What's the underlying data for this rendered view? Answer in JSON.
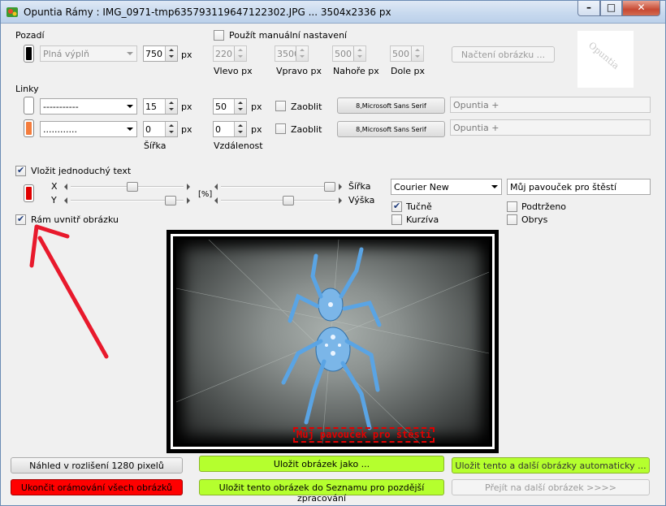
{
  "window": {
    "title": "Opuntia Rámy : IMG_0971-tmp635793119647122302.JPG ... 3504x2336 px",
    "controls": {
      "minimize": "–",
      "maximize": "□",
      "close": "✕"
    }
  },
  "background": {
    "section_label": "Pozadí",
    "swatch_color": "#000000",
    "fill_select": "Plná výplň",
    "width_value": "750",
    "unit": "px",
    "manual_checkbox_label": "Použít manuální nastavení",
    "manual_checked": false,
    "left_value": "220",
    "right_value": "3500",
    "top_value": "500",
    "bottom_value": "500",
    "left_label": "Vlevo px",
    "right_label": "Vpravo px",
    "top_label": "Nahoře px",
    "bottom_label": "Dole px",
    "load_image_button": "Načtení obrázku ...",
    "logo_text": "Opuntia"
  },
  "lines": {
    "section_label": "Linky",
    "rows": [
      {
        "swatch_color": "#ffffff",
        "style": "-----------",
        "width": "15",
        "distance": "50",
        "blur_label": "Zaoblit",
        "blur_checked": false,
        "font_button": "8,Microsoft Sans Serif",
        "text": "Opuntia +"
      },
      {
        "swatch_color": "#f47c3c",
        "style": "............",
        "width": "0",
        "distance": "0",
        "blur_label": "Zaoblit",
        "blur_checked": false,
        "font_button": "8,Microsoft Sans Serif",
        "text": "Opuntia +"
      }
    ],
    "unit": "px",
    "width_label": "Šířka",
    "distance_label": "Vzdálenost"
  },
  "simple_text": {
    "checkbox_label": "Vložit jednoduchý text",
    "checked": true,
    "swatch_color": "#e00000",
    "x_label": "X",
    "y_label": "Y",
    "percent_label": "[%]",
    "width_label": "Šířka",
    "height_label": "Výška",
    "x_value": 0.55,
    "y_value": 0.93,
    "width_value": 1.0,
    "height_value": 0.6,
    "font_select": "Courier New",
    "text_value": "Můj pavouček pro štěstí",
    "bold_label": "Tučně",
    "bold_checked": true,
    "italic_label": "Kurzíva",
    "italic_checked": false,
    "underline_label": "Podtrženo",
    "underline_checked": false,
    "outline_label": "Obrys",
    "outline_checked": false
  },
  "frame_inside": {
    "checkbox_label": "Rám uvnitř obrázku",
    "checked": true
  },
  "preview": {
    "overlay_text": "Můj pavouček pro štěstí",
    "overlay_color": "#e00000"
  },
  "buttons": {
    "preview_1280": "Náhled v rozlišení 1280 pixelů",
    "save_as": "Uložit obrázek jako ...",
    "save_auto": "Uložit tento a další obrázky automaticky ...",
    "quit_all": "Ukončit orámování všech obrázků",
    "save_to_list": "Uložit tento obrázek do Seznamu pro pozdější zpracování",
    "next_image": "Přejít na další obrázek    >>>>"
  },
  "colors": {
    "green_button": "#b5ff2e",
    "red_button": "#ff0000",
    "annotation_arrow": "#e8192c"
  }
}
